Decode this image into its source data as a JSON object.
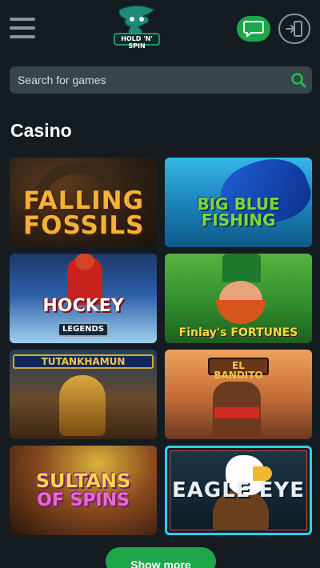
{
  "header": {
    "logo_text": "HOLD 'N' SPIN",
    "menu_icon": "hamburger-menu-icon",
    "chat_icon": "chat-bubble-icon",
    "login_icon": "login-icon",
    "accent_color": "#1ea64a"
  },
  "search": {
    "placeholder": "Search for games",
    "icon": "search-icon"
  },
  "casino": {
    "title": "Casino",
    "games": [
      {
        "title": "FALLING FOSSILS"
      },
      {
        "title": "BIG BLUE FISHING"
      },
      {
        "title": "HOCKEY",
        "subtitle": "LEGENDS"
      },
      {
        "title": "Finlay's FORTUNES"
      },
      {
        "title": "TUTANKHAMUN"
      },
      {
        "title": "EL BANDITO"
      },
      {
        "title": "SULTANS",
        "title2": "OF SPINS"
      },
      {
        "title": "EAGLE EYE"
      }
    ]
  },
  "show_more_label": "Show more"
}
